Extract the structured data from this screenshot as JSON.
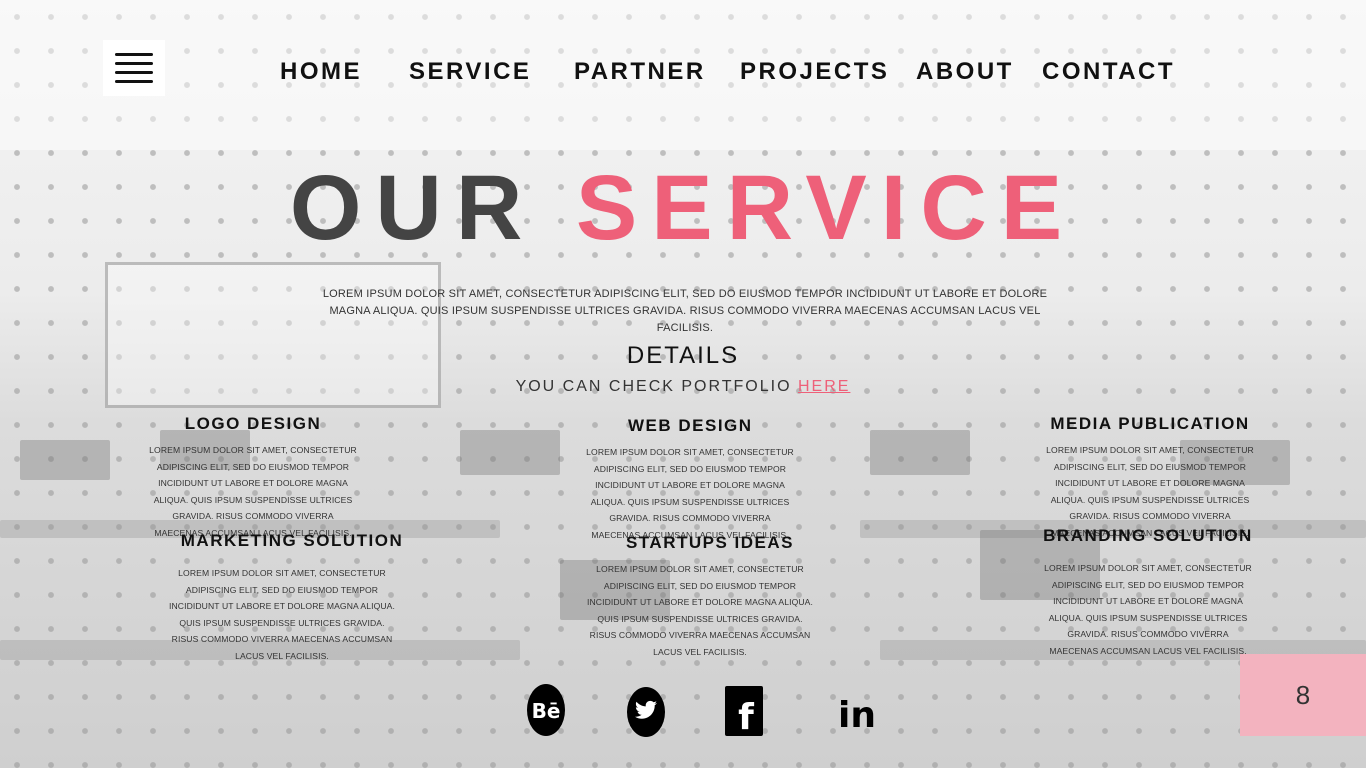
{
  "nav": {
    "items": [
      "HOME",
      "SERVICE",
      "PARTNER",
      "PROJECTS",
      "ABOUT",
      "CONTACT"
    ]
  },
  "menu_icon": "hamburger-menu-icon",
  "hero": {
    "title_part1": "OUR",
    "title_part2": "SERVICE",
    "intro": "LOREM IPSUM DOLOR SIT AMET, CONSECTETUR ADIPISCING ELIT, SED DO EIUSMOD TEMPOR INCIDIDUNT UT LABORE ET DOLORE MAGNA ALIQUA. QUIS IPSUM SUSPENDISSE ULTRICES GRAVIDA. RISUS COMMODO VIVERRA MAECENAS ACCUMSAN LACUS VEL FACILISIS."
  },
  "details": {
    "heading": "DETAILS",
    "subtitle": "YOU CAN CHECK PORTFOLIO",
    "link": "HERE"
  },
  "services": [
    {
      "title": "LOGO DESIGN",
      "text": "LOREM IPSUM DOLOR SIT AMET, CONSECTETUR ADIPISCING ELIT, SED DO EIUSMOD TEMPOR INCIDIDUNT UT LABORE ET DOLORE MAGNA ALIQUA. QUIS IPSUM SUSPENDISSE ULTRICES GRAVIDA. RISUS COMMODO VIVERRA MAECENAS ACCUMSAN LACUS VEL FACILISIS."
    },
    {
      "title": "WEB DESIGN",
      "text": "LOREM IPSUM DOLOR SIT AMET, CONSECTETUR ADIPISCING ELIT, SED DO EIUSMOD TEMPOR INCIDIDUNT UT LABORE ET DOLORE MAGNA ALIQUA. QUIS IPSUM SUSPENDISSE ULTRICES GRAVIDA. RISUS COMMODO VIVERRA MAECENAS ACCUMSAN LACUS VEL FACILISIS."
    },
    {
      "title": "MEDIA PUBLICATION",
      "text": "LOREM IPSUM DOLOR SIT AMET, CONSECTETUR ADIPISCING ELIT, SED DO EIUSMOD TEMPOR INCIDIDUNT UT LABORE ET DOLORE MAGNA ALIQUA. QUIS IPSUM SUSPENDISSE ULTRICES GRAVIDA. RISUS COMMODO VIVERRA MAECENAS ACCUMSAN LACUS VEL FACILISIS."
    },
    {
      "title": "MARKETING SOLUTION",
      "text": "LOREM IPSUM DOLOR SIT AMET, CONSECTETUR ADIPISCING ELIT, SED DO EIUSMOD TEMPOR INCIDIDUNT UT LABORE ET DOLORE MAGNA ALIQUA. QUIS IPSUM SUSPENDISSE ULTRICES GRAVIDA. RISUS COMMODO VIVERRA MAECENAS ACCUMSAN LACUS VEL FACILISIS."
    },
    {
      "title": "STARTUPS IDEAS",
      "text": "LOREM IPSUM DOLOR SIT AMET, CONSECTETUR ADIPISCING ELIT, SED DO EIUSMOD TEMPOR INCIDIDUNT UT LABORE ET DOLORE MAGNA ALIQUA. QUIS IPSUM SUSPENDISSE ULTRICES GRAVIDA. RISUS COMMODO VIVERRA MAECENAS ACCUMSAN LACUS VEL FACILISIS."
    },
    {
      "title": "BRANDING SOLUTION",
      "text": "LOREM IPSUM DOLOR SIT AMET, CONSECTETUR ADIPISCING ELIT, SED DO EIUSMOD TEMPOR INCIDIDUNT UT LABORE ET DOLORE MAGNA ALIQUA. QUIS IPSUM SUSPENDISSE ULTRICES GRAVIDA. RISUS COMMODO VIVERRA MAECENAS ACCUMSAN LACUS VEL FACILISIS."
    }
  ],
  "social": [
    {
      "name": "behance-icon",
      "glyph": "Bē"
    },
    {
      "name": "twitter-icon",
      "glyph": ""
    },
    {
      "name": "facebook-icon",
      "glyph": "f"
    },
    {
      "name": "linkedin-icon",
      "glyph": "in"
    }
  ],
  "page_number": "8",
  "colors": {
    "accent": "#ee6079",
    "title_dark": "#444444",
    "page_badge": "#f3b3bf"
  }
}
